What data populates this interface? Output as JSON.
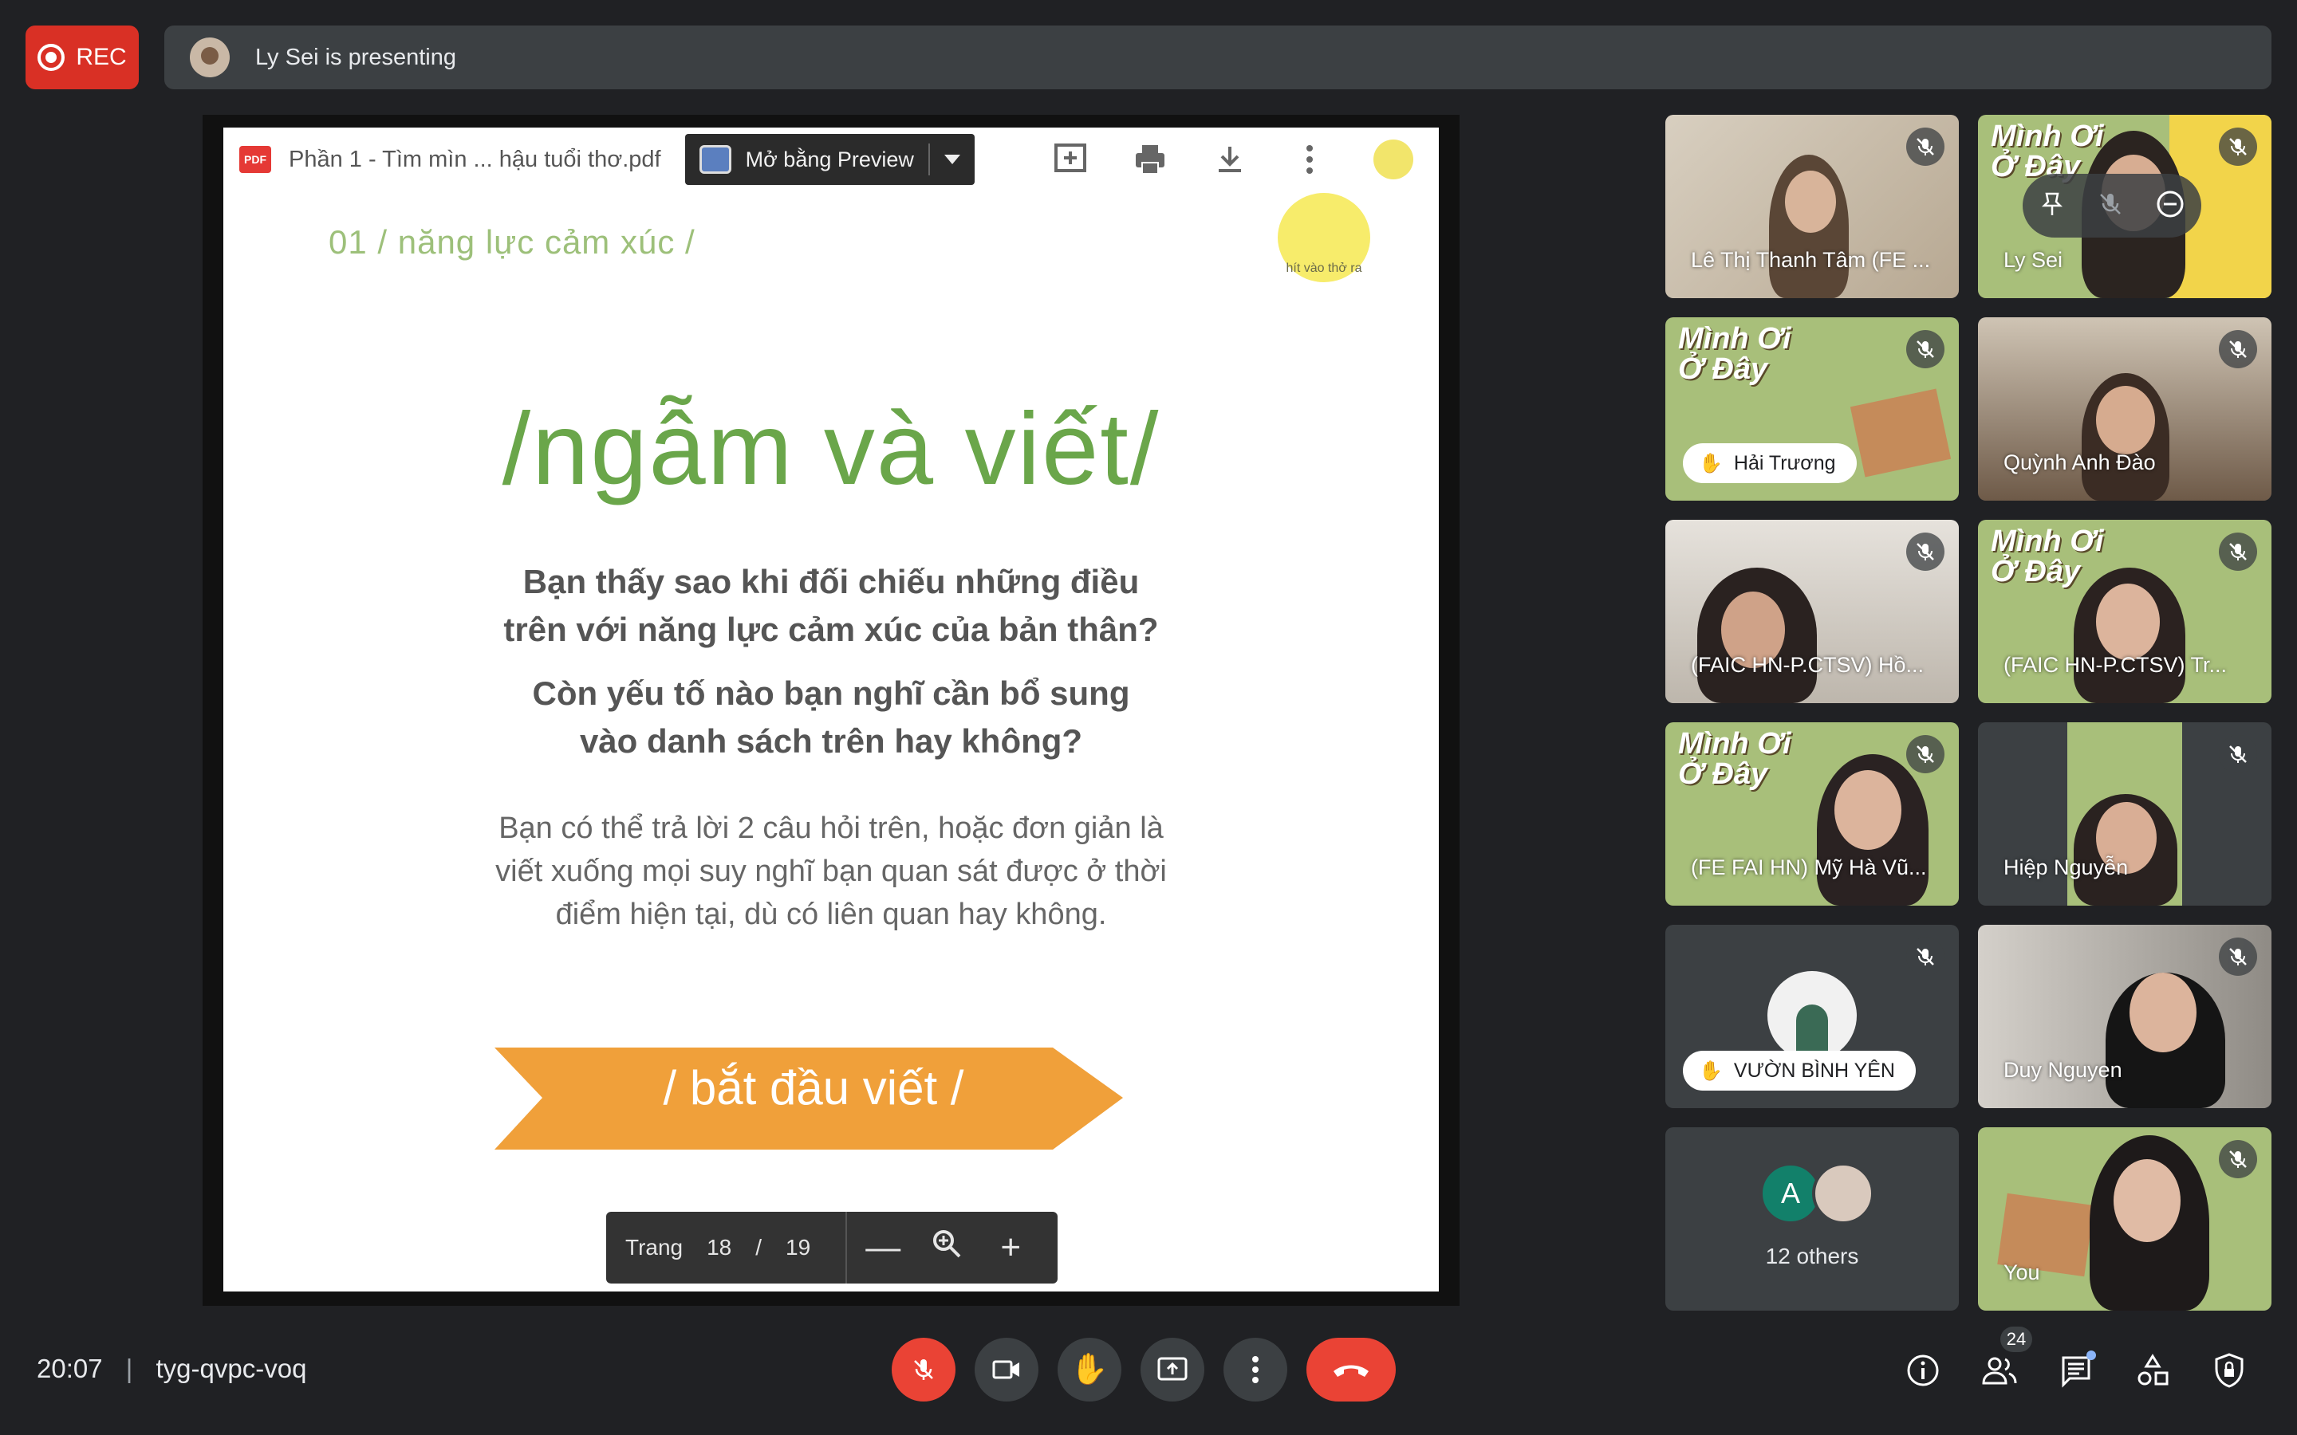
{
  "header": {
    "rec_label": "REC",
    "presenting_text": "Ly Sei is presenting"
  },
  "viewer": {
    "file_name": "Phần 1 - Tìm mìn ... hậu tuổi thơ.pdf",
    "pdf_icon_text": "PDF",
    "open_with_label": "Mở bằng Preview",
    "page_label": "Trang",
    "page_current": "18",
    "page_separator": "/",
    "page_total": "19"
  },
  "slide": {
    "section": "01 / năng lực cảm xúc /",
    "badge_text": "hít vào thở ra",
    "title": "/ngẫm và viết/",
    "question1_line1": "Bạn thấy sao khi đối chiếu những điều",
    "question1_line2": "trên với năng lực cảm xúc của bản thân?",
    "question2_line1": "Còn yếu tố nào bạn nghĩ cần bổ sung",
    "question2_line2": "vào danh sách trên hay không?",
    "body_line1": "Bạn có thể trả lời 2 câu hỏi trên, hoặc đơn giản là",
    "body_line2": "viết xuống mọi suy nghĩ bạn quan sát được ở thời",
    "body_line3": "điểm hiện tại, dù có liên quan hay không.",
    "cta": "/ bắt đầu viết /",
    "colors": {
      "green": "#6aa64a",
      "orange": "#f0a03a"
    }
  },
  "background_sign": {
    "line1": "Mình Ơi",
    "line2": "Ở Đây"
  },
  "participants": [
    {
      "name": "Lê Thị Thanh Tâm (FE ..."
    },
    {
      "name": "Ly Sei"
    },
    {
      "name": "Hải Trương"
    },
    {
      "name": "Quỳnh Anh Đào"
    },
    {
      "name": "(FAIC HN-P.CTSV) Hồ..."
    },
    {
      "name": "(FAIC HN-P.CTSV) Tr..."
    },
    {
      "name": "(FE FAI HN) Mỹ Hà Vũ..."
    },
    {
      "name": "Hiệp Nguyễn"
    },
    {
      "name": "VƯỜN BÌNH YÊN"
    },
    {
      "name": "Duy Nguyen"
    },
    {
      "name": "12 others",
      "avatar_letter": "A"
    },
    {
      "name": "You"
    }
  ],
  "footer": {
    "time": "20:07",
    "separator": "|",
    "meeting_code": "tyg-qvpc-voq",
    "people_count": "24"
  }
}
